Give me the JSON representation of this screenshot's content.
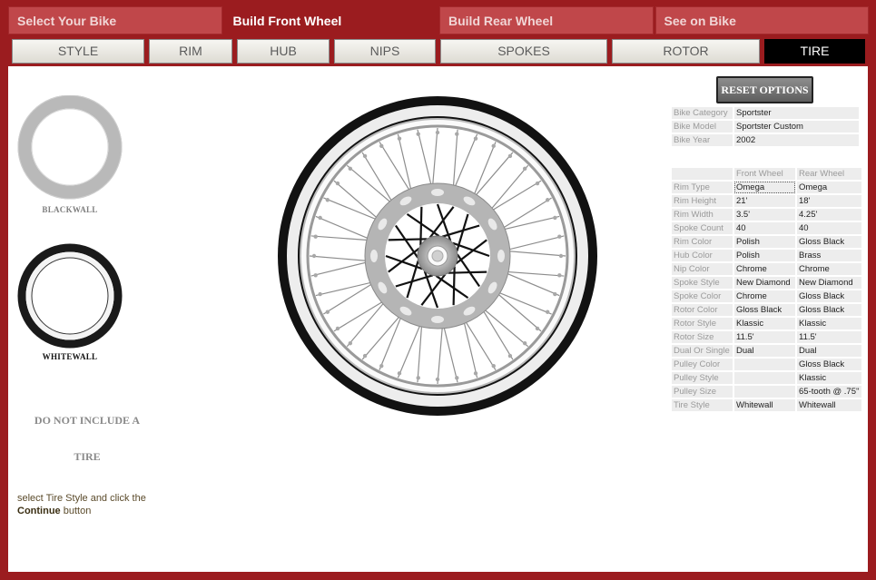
{
  "steps": [
    {
      "label": "Select Your Bike",
      "active": false
    },
    {
      "label": "Build Front Wheel",
      "active": true
    },
    {
      "label": "Build Rear Wheel",
      "active": false
    },
    {
      "label": "See on Bike",
      "active": false
    }
  ],
  "component_tabs": [
    {
      "label": "STYLE",
      "active": false
    },
    {
      "label": "RIM",
      "active": false
    },
    {
      "label": "HUB",
      "active": false
    },
    {
      "label": "NIPS",
      "active": false
    },
    {
      "label": "SPOKES",
      "active": false
    },
    {
      "label": "ROTOR",
      "active": false
    },
    {
      "label": "TIRE",
      "active": true
    }
  ],
  "tire_options": [
    {
      "label": "BLACKWALL",
      "selected": false
    },
    {
      "label": "WHITEWALL",
      "selected": true
    }
  ],
  "no_include": {
    "line1": "DO NOT INCLUDE A",
    "line2": "TIRE"
  },
  "hint": {
    "prefix": "select Tire Style and click the",
    "bold": "Continue",
    "suffix": " button"
  },
  "reset_label": "RESET OPTIONS",
  "bike_info": [
    {
      "key": "Bike Category",
      "value": "Sportster"
    },
    {
      "key": "Bike Model",
      "value": "Sportster Custom"
    },
    {
      "key": "Bike Year",
      "value": "2002"
    }
  ],
  "spec_headers": {
    "front": "Front Wheel",
    "rear": "Rear Wheel"
  },
  "specs": [
    {
      "key": "Rim Type",
      "front": "Omega",
      "rear": "Omega"
    },
    {
      "key": "Rim Height",
      "front": "21'",
      "rear": "18'"
    },
    {
      "key": "Rim Width",
      "front": "3.5'",
      "rear": "4.25'"
    },
    {
      "key": "Spoke Count",
      "front": "40",
      "rear": "40"
    },
    {
      "key": "Rim Color",
      "front": "Polish",
      "rear": "Gloss Black"
    },
    {
      "key": "Hub Color",
      "front": "Polish",
      "rear": "Brass"
    },
    {
      "key": "Nip Color",
      "front": "Chrome",
      "rear": "Chrome"
    },
    {
      "key": "Spoke Style",
      "front": "New Diamond",
      "rear": "New Diamond"
    },
    {
      "key": "Spoke Color",
      "front": "Chrome",
      "rear": "Gloss Black"
    },
    {
      "key": "Rotor Color",
      "front": "Gloss Black",
      "rear": "Gloss Black"
    },
    {
      "key": "Rotor Style",
      "front": "Klassic",
      "rear": "Klassic"
    },
    {
      "key": "Rotor Size",
      "front": "11.5'",
      "rear": "11.5'"
    },
    {
      "key": "Dual Or Single",
      "front": "Dual",
      "rear": "Dual"
    },
    {
      "key": "Pulley Color",
      "front": "",
      "rear": "Gloss Black"
    },
    {
      "key": "Pulley Style",
      "front": "",
      "rear": "Klassic"
    },
    {
      "key": "Pulley Size",
      "front": "",
      "rear": "65-tooth @ .75''"
    },
    {
      "key": "Tire Style",
      "front": "Whitewall",
      "rear": "Whitewall"
    }
  ],
  "colors": {
    "brand_red": "#9b1c1f",
    "tab_red": "#c0474a",
    "active_black": "#000000"
  }
}
